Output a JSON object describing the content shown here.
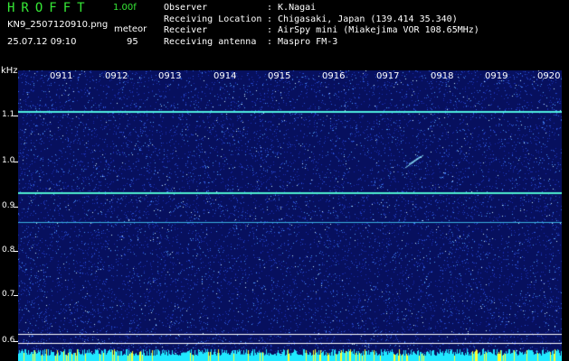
{
  "header": {
    "app_name": "HROFFT",
    "version": "1.00f",
    "filename": "KN9_2507120910.png",
    "meteor_label": "meteor",
    "datetime": "25.07.12 09:10",
    "meteor_count": "95"
  },
  "info": [
    {
      "key": "Observer",
      "value": ": K.Nagai"
    },
    {
      "key": "Receiving Location",
      "value": ": Chigasaki, Japan (139.414 35.340)"
    },
    {
      "key": "Receiver",
      "value": ": AirSpy mini (Miakejima VOR 108.65MHz)"
    },
    {
      "key": "Receiving antenna",
      "value": ": Maspro FM-3"
    }
  ],
  "spectrogram": {
    "y_unit": "kHz",
    "y_ticks": [
      "1.1",
      "1.0",
      "0.9",
      "0.8",
      "0.7",
      "0.6"
    ],
    "x_ticks": [
      "0911",
      "0912",
      "0913",
      "0914",
      "0915",
      "0916",
      "0917",
      "0918",
      "0919",
      "0920"
    ],
    "colors": {
      "background": "#07105e",
      "signal": "#ffffff",
      "text_green": "#36e836"
    }
  }
}
